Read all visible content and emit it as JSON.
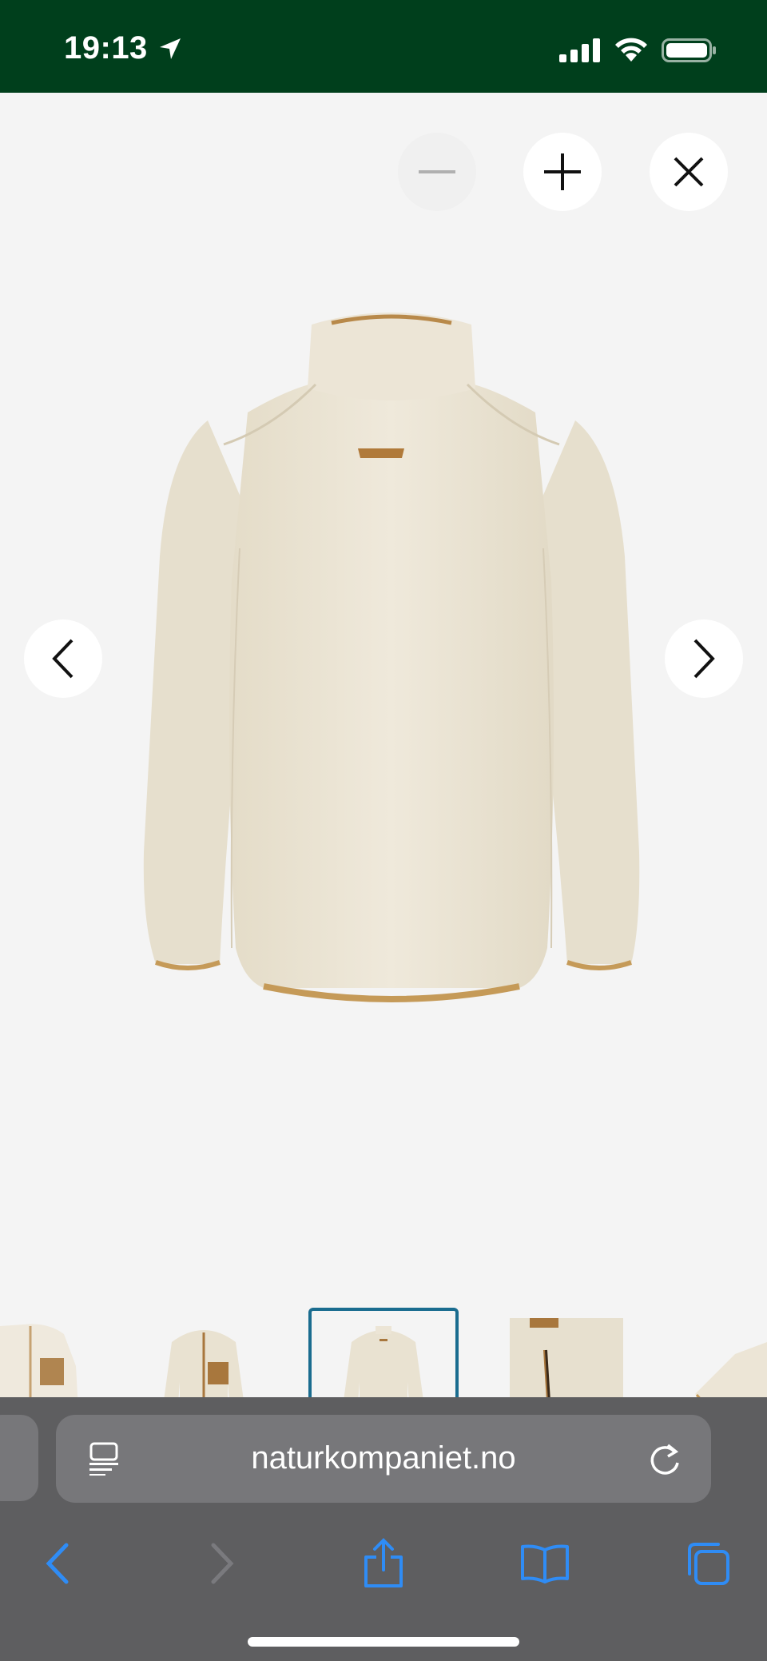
{
  "status_bar": {
    "time": "19:13",
    "background": "#003f1c"
  },
  "viewer": {
    "controls": {
      "zoom_out_icon": "minus-icon",
      "zoom_in_icon": "plus-icon",
      "close_icon": "close-icon",
      "prev_icon": "chevron-left-icon",
      "next_icon": "chevron-right-icon"
    },
    "main_image": "fleece-jacket-back-view",
    "thumbnails": [
      {
        "image": "fleece-jacket-front-cropped"
      },
      {
        "image": "fleece-jacket-front-open"
      },
      {
        "image": "fleece-jacket-back",
        "selected": true
      },
      {
        "image": "fleece-pocket-detail"
      },
      {
        "image": "fleece-sleeve-detail"
      }
    ],
    "selected_border_color": "#1a6c8f"
  },
  "safari": {
    "url": "naturkompaniet.no",
    "toolbar": {
      "back_icon": "chevron-left-icon",
      "forward_icon": "chevron-right-icon",
      "share_icon": "share-icon",
      "bookmarks_icon": "book-icon",
      "tabs_icon": "tabs-icon"
    },
    "accent": "#2f8cf5"
  }
}
